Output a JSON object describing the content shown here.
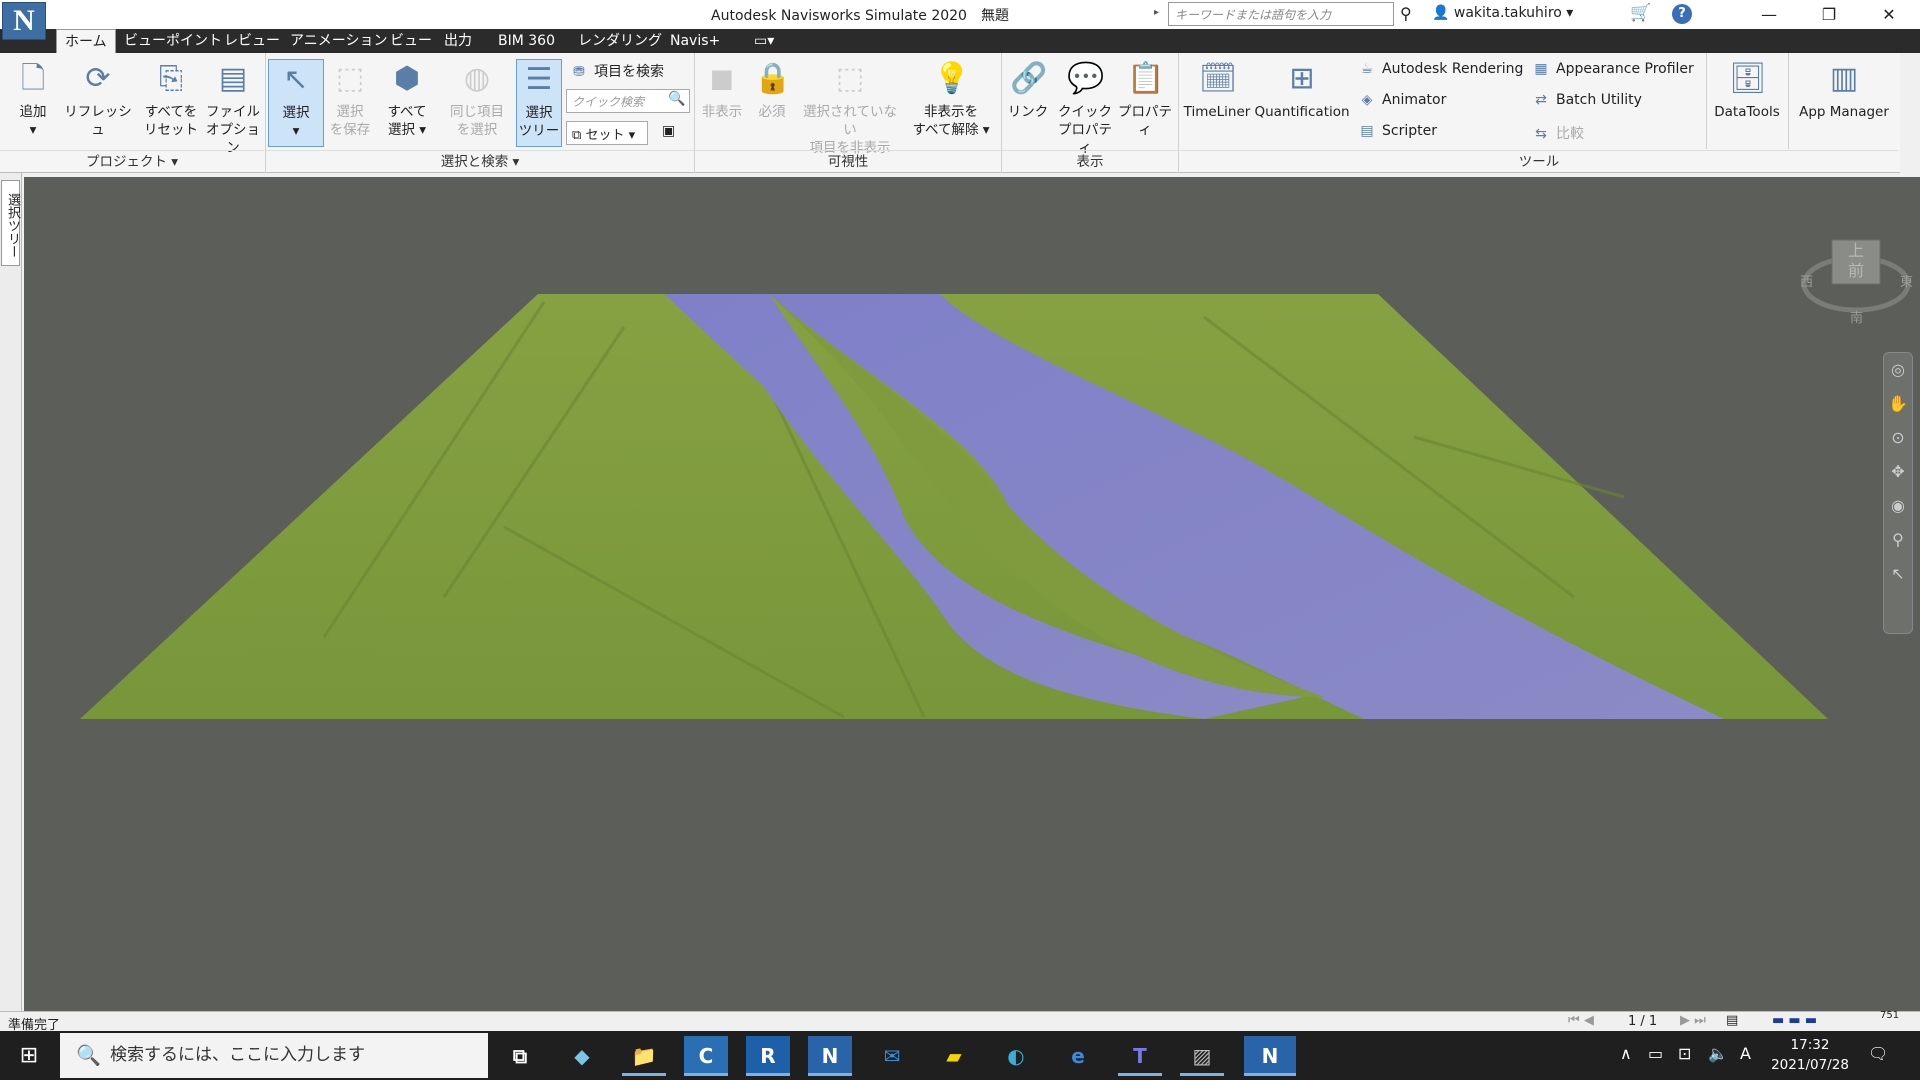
{
  "titlebar": {
    "app_icon": "N",
    "title": "Autodesk Navisworks Simulate 2020　無題",
    "search_placeholder": "キーワードまたは語句を入力",
    "user": "wakita.takuhiro"
  },
  "tabs": [
    {
      "label": "ホーム",
      "active": true
    },
    {
      "label": "ビューポイント"
    },
    {
      "label": "レビュー"
    },
    {
      "label": "アニメーション"
    },
    {
      "label": "ビュー"
    },
    {
      "label": "出力"
    },
    {
      "label": "BIM 360"
    },
    {
      "label": "レンダリング"
    },
    {
      "label": "Navis+"
    }
  ],
  "ribbon": {
    "project": {
      "group_label": "プロジェクト",
      "add": "追加",
      "refresh": "リフレッシュ",
      "reset_all_1": "すべてを",
      "reset_all_2": "リセット",
      "file_opt_1": "ファイル",
      "file_opt_2": "オプション"
    },
    "select": {
      "group_label": "選択と検索",
      "select": "選択",
      "save_sel_1": "選択",
      "save_sel_2": "を保存",
      "select_all_1": "すべて",
      "select_all_2": "選択",
      "same_1": "同じ項目",
      "same_2": "を選択",
      "tree_1": "選択",
      "tree_2": "ツリー",
      "find_items": "項目を検索",
      "quick_find_placeholder": "クイック検索",
      "sets": "セット"
    },
    "visibility": {
      "group_label": "可視性",
      "hide": "非表示",
      "require": "必須",
      "hide_unsel_1": "選択されていない",
      "hide_unsel_2": "項目を非表示",
      "unhide_1": "非表示を",
      "unhide_2": "すべて解除"
    },
    "display": {
      "group_label": "表示",
      "links": "リンク",
      "quick_prop_1": "クイック",
      "quick_prop_2": "プロパティ",
      "properties": "プロパティ"
    },
    "tools": {
      "group_label": "ツール",
      "timeliner": "TimeLiner",
      "quantification": "Quantification",
      "autodesk_rendering": "Autodesk Rendering",
      "animator": "Animator",
      "scripter": "Scripter",
      "appearance_profiler": "Appearance Profiler",
      "batch_utility": "Batch Utility",
      "compare": "比較",
      "datatools": "DataTools",
      "app_manager": "App Manager"
    }
  },
  "left_panel": {
    "tab": "選択ツリー"
  },
  "viewcube": {
    "top": "上",
    "front": "前",
    "west": "西",
    "east": "東",
    "south": "南"
  },
  "status": {
    "text": "準備完了",
    "page": "1 / 1",
    "memory": "751"
  },
  "taskbar": {
    "search_placeholder": "検索するには、ここに入力します",
    "time": "17:32",
    "date": "2021/07/28",
    "ime": "A"
  },
  "colors": {
    "terrain": "#7d9a3c",
    "water": "#8484c4",
    "viewport_bg": "#5c5e59",
    "tabbar": "#2b2b2b",
    "taskbar": "#1f1f1f"
  }
}
